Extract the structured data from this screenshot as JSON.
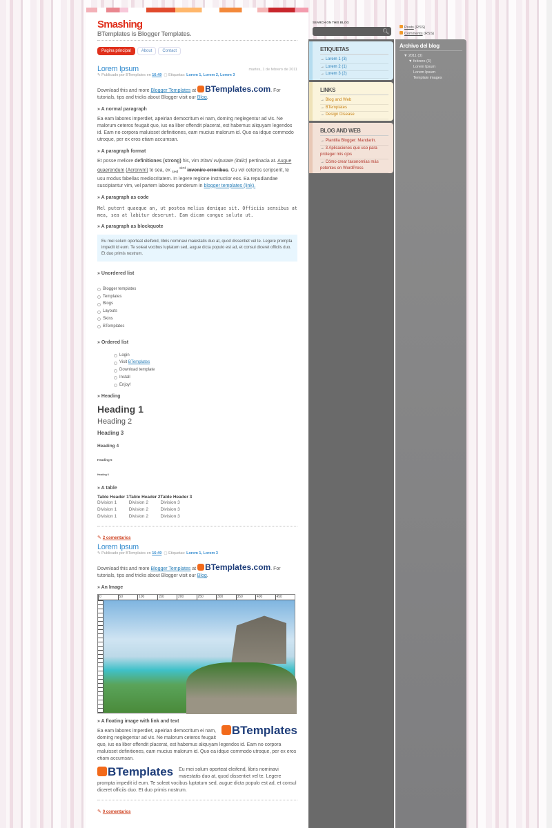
{
  "header": {
    "title": "Smashing",
    "description": "BTemplates is Blogger Templates."
  },
  "tabs": [
    "Pagina principal",
    "About",
    "Contact"
  ],
  "post1": {
    "title": "Lorem Ipsum",
    "date": "martes, 1 de febrero de 2011",
    "published_by": "Publicado por BTemplates en",
    "time": "16:49",
    "labels_prefix": "Etiquetas:",
    "labels": "Lorem 1, Lorem 2, Lorem 3",
    "intro_a": "Download this and more",
    "intro_link": "Blogger Templates",
    "intro_at": "at",
    "logo": "BTemplates.com",
    "intro_b": ". For tutorials, tips and tricks about Blogger visit our",
    "intro_blog": "Blog",
    "s_normal": "» A normal paragraph",
    "normal": "Ea eam labores imperdiet, apeirian democritum ei nam, doming neglegentur ad vis. Ne malorum ceteros feugait quo, ius ea liber offendit placerat, est habemus aliquyam legendos id. Eam no corpora maluisset definitiones, eam mucius malorum id. Quo ea idque commodo utroque, per ex eros etiam accumsan.",
    "s_format": "» A paragraph format",
    "f1": "Et posse meliore",
    "f_strong": "definitiones (strong)",
    "f2": "his, vim",
    "f_ital1": "tritani vulputate",
    "f_ital2": "(italic)",
    "f3": "pertinacia at.",
    "f_abbr": "Augue quaerendum",
    "f_acr": "(Acronym)",
    "f4": "te sea, ex",
    "f_sub": "sed",
    "f_sup": "sint",
    "f_del": "invenire erroribus",
    "f5": ". Cu vel ceteros scripserit, te usu modus fabellas mediocritatem. In legere regione instructior eos. Ea repudiandae suscipiantur vim, vel partem labores ponderum in",
    "f_link": "blogger templates (link).",
    "s_code": "» A paragraph as code",
    "code": "Mel putent quaeque an, ut postea melius denique sit. Officiis sensibus at mea, sea at labitur deserunt. Eam dicam congue soluta ut.",
    "s_quote": "» A paragraph as blockquote",
    "quote": "Eu mei solum oporteat eleifend, libris nominavi maiestatis duo at, quod dissentiet vel te. Legere prompta impedit id eum. Te soleat vocibus luptatum sed, augue dicta populo est ad, et consul diceret officiis duo. Et duo primis nostrum.",
    "s_ul": "» Unordered list",
    "ul": [
      "Blogger templates",
      "Templates",
      "Blogs",
      "Layouts",
      "Skins",
      "BTemplates"
    ],
    "s_ol": "» Ordered list",
    "ol": [
      "Login",
      "Visit",
      "Download template",
      "Install",
      "Enjoy!"
    ],
    "ol_link": "BTemplates",
    "s_heading": "» Heading",
    "headings": [
      "Heading 1",
      "Heading 2",
      "Heading 3",
      "Heading 4",
      "Heading 5",
      "Heading 6"
    ],
    "s_table": "» A table",
    "table": {
      "headers": [
        "Table Header 1",
        "Table Header 2",
        "Table Header 3"
      ],
      "rows": [
        [
          "Division 1",
          "Division 2",
          "Division 3"
        ],
        [
          "Division 1",
          "Division 2",
          "Division 3"
        ],
        [
          "Division 1",
          "Division 2",
          "Division 3"
        ]
      ]
    },
    "comments": "2 comentarios"
  },
  "post2": {
    "title": "Lorem Ipsum",
    "published_by": "Publicado por BTemplates en",
    "time": "16:49",
    "labels_prefix": "Etiquetas:",
    "labels": "Lorem 1, Lorem 3",
    "s_image": "» An Image",
    "ruler": [
      "0",
      "50",
      "100",
      "150",
      "200",
      "250",
      "300",
      "350",
      "400",
      "450"
    ],
    "s_float": "» A floating image with link and text",
    "float1": "Ea eam labores imperdiet, apeirian democritum ei nam, doming neglegentur ad vis. Ne malorum ceteros feugait quo, ius ea liber offendit placerat, est habemus aliquyam legendos id. Eam no corpora maluisset definitiones, eam mucius malorum id. Quo ea idque commodo utroque, per ex eros etiam accumsan.",
    "float2": "Eu mei solum oporteat eleifend, libris nominavi maiestatis duo at, quod dissentiet vel te. Legere prompta impedit id eum. Te soleat vocibus luptatum sed, augue dicta populo est ad, et consul diceret officiis duo. Et duo primis nostrum.",
    "logo": "BTemplates",
    "comments": "0 comentarios"
  },
  "search": {
    "label": "SEARCH ON THIS BLOG",
    "placeholder": ""
  },
  "rss": {
    "posts": "Posts",
    "comments": "Comments",
    "suffix": "(RSS)"
  },
  "widgets": {
    "etiquetas": {
      "title": "ETIQUETAS",
      "items": [
        "Lorem 1 (3)",
        "Lorem 2 (1)",
        "Lorem 3 (2)"
      ],
      "color": "#daeef8"
    },
    "links": {
      "title": "LINKS",
      "items": [
        "Blog and Web",
        "BTemplates",
        "Design Disease"
      ],
      "color": "#fbf4dc"
    },
    "blogweb": {
      "title": "BLOG AND WEB",
      "items": [
        "Plantilla Blogger: Mandarin.",
        "3 Aplicaciones que uso para proteger mis ojos",
        "Cómo crear taxonomías más potentes en WordPress"
      ],
      "color": "#f3e2d8"
    }
  },
  "archive": {
    "title": "Archivo del blog",
    "year": "2011 (3)",
    "month": "febrero (3)",
    "posts": [
      "Lorem Ipsum",
      "Lorem Ipsum",
      "Template images"
    ]
  }
}
